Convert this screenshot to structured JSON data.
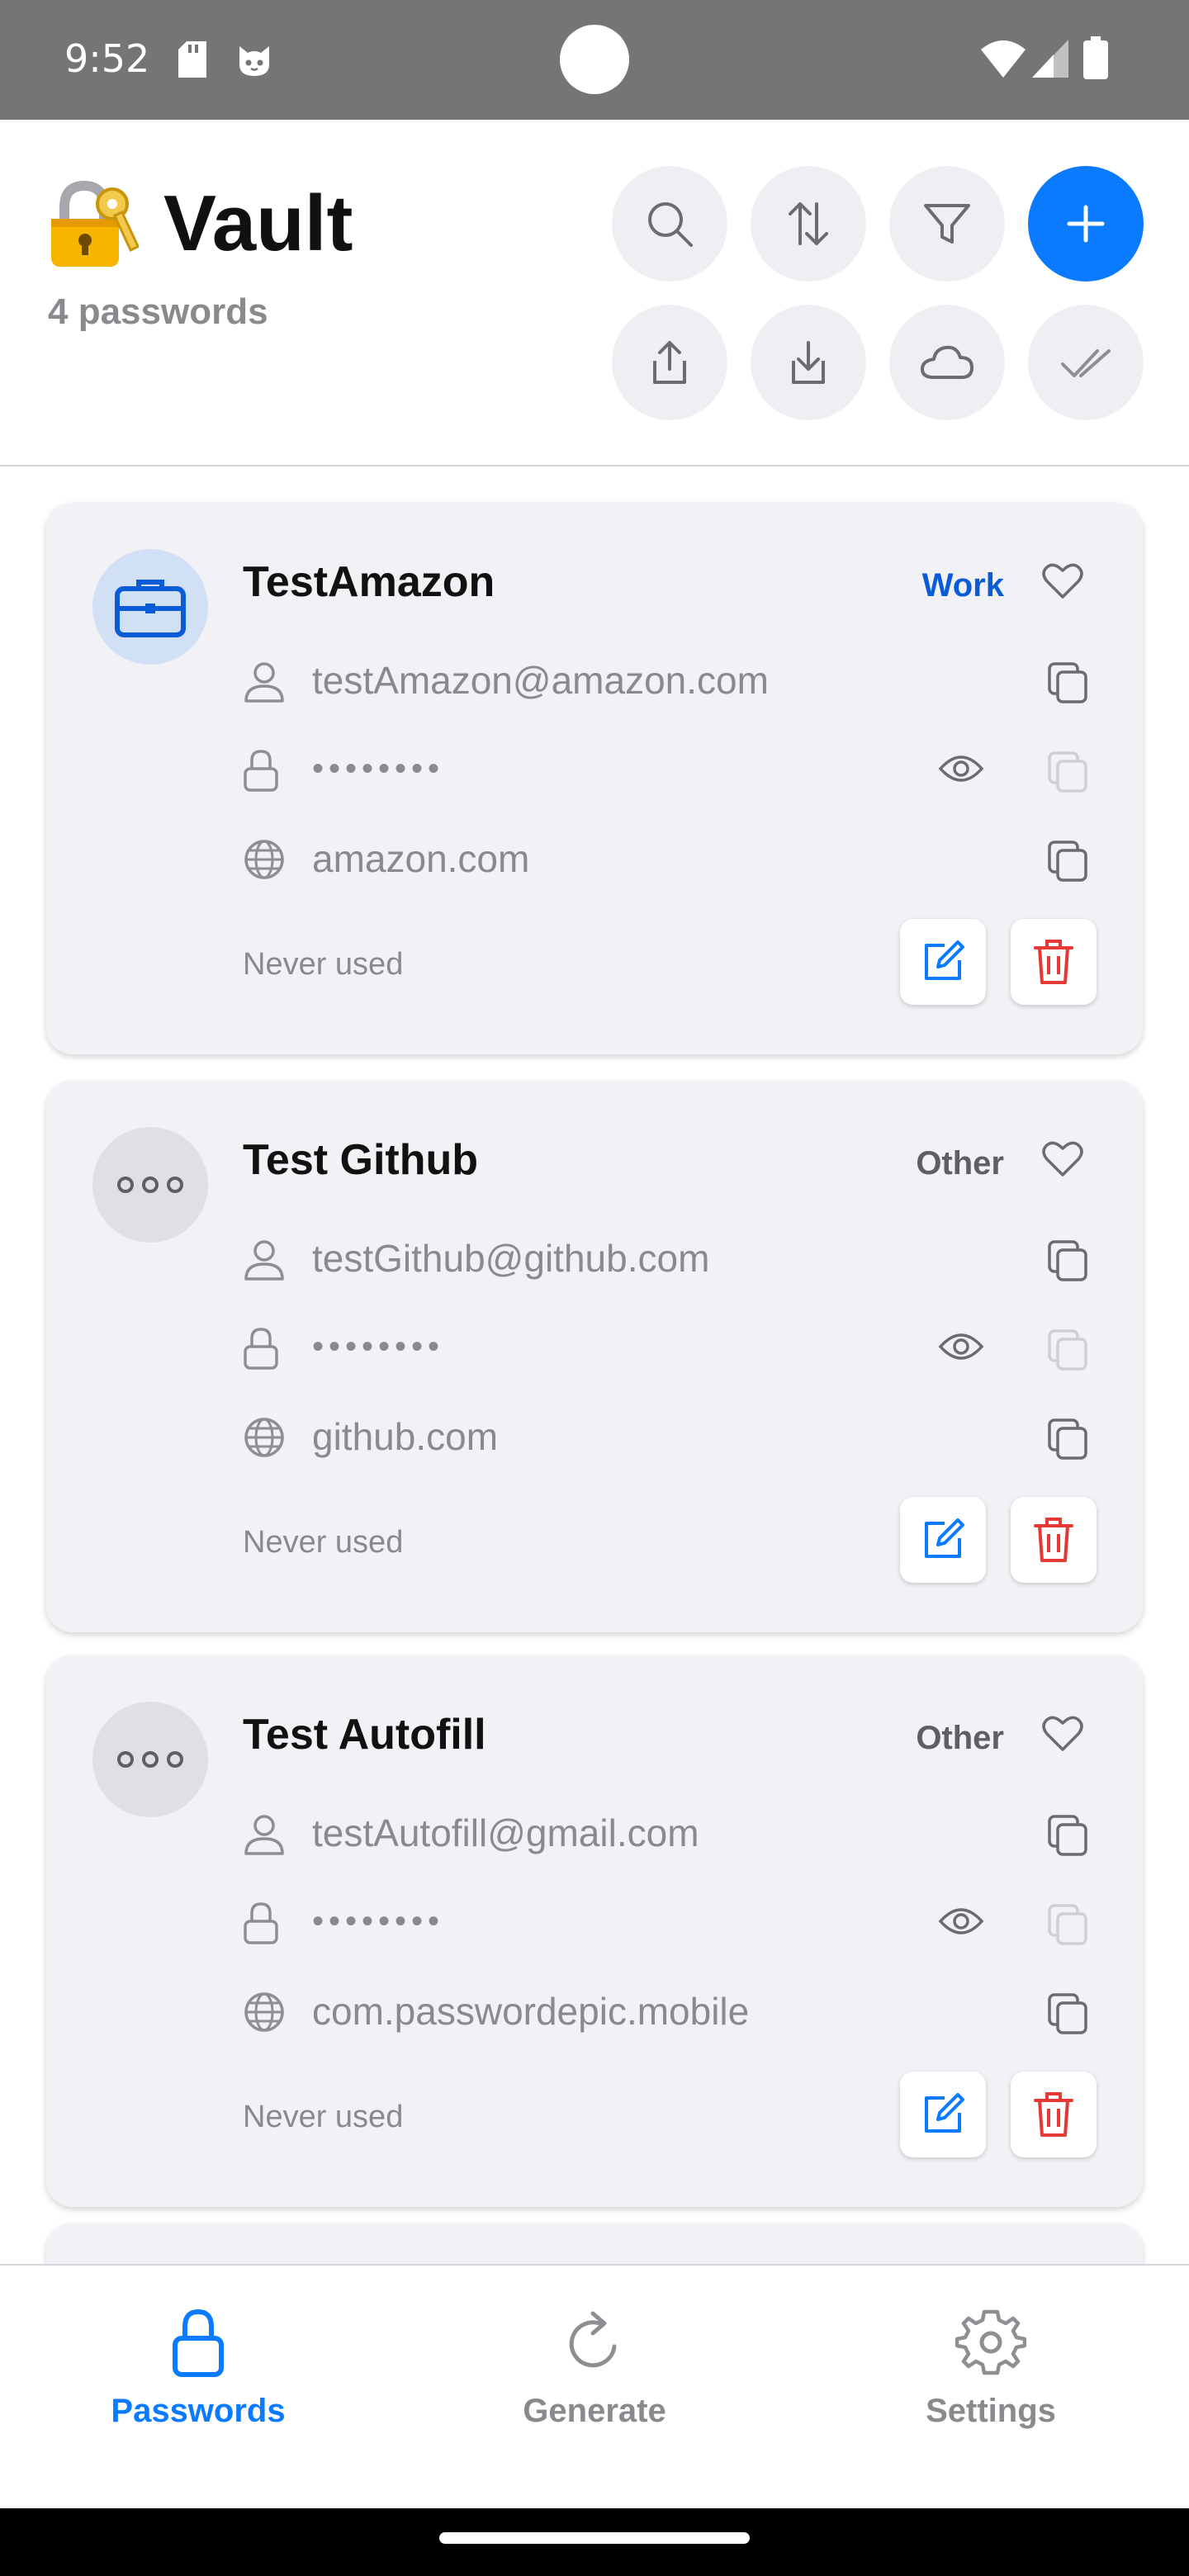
{
  "status_bar": {
    "time": "9:52"
  },
  "header": {
    "title": "Vault",
    "subtitle": "4 passwords",
    "actions": [
      "search-icon",
      "sort-icon",
      "filter-icon",
      "add-icon",
      "share-icon",
      "import-icon",
      "cloud-icon",
      "select-all-icon"
    ]
  },
  "entries": [
    {
      "title": "TestAmazon",
      "category": "Work",
      "category_color": "#0a5bd6",
      "username": "testAmazon@amazon.com",
      "password": "••••••••",
      "website": "amazon.com",
      "last_used": "Never used",
      "icon": "briefcase-icon"
    },
    {
      "title": "Test Github",
      "category": "Other",
      "category_color": "#5f5f63",
      "username": "testGithub@github.com",
      "password": "••••••••",
      "website": "github.com",
      "last_used": "Never used",
      "icon": "more-dots-icon"
    },
    {
      "title": "Test Autofill",
      "category": "Other",
      "category_color": "#5f5f63",
      "username": "testAutofill@gmail.com",
      "password": "••••••••",
      "website": "com.passwordepic.mobile",
      "last_used": "Never used",
      "icon": "more-dots-icon"
    }
  ],
  "bottom_nav": {
    "items": [
      {
        "label": "Passwords",
        "icon": "lock-icon",
        "active": true
      },
      {
        "label": "Generate",
        "icon": "refresh-icon",
        "active": false
      },
      {
        "label": "Settings",
        "icon": "gear-icon",
        "active": false
      }
    ]
  },
  "colors": {
    "accent": "#0a7bff",
    "danger": "#e53935",
    "card_bg": "#f2f2f6",
    "status_bar": "#757575"
  }
}
